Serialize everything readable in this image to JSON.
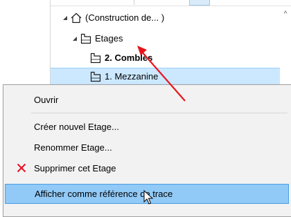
{
  "tree": {
    "items": [
      {
        "label": "(Construction de... )",
        "expanded": true,
        "bold": false,
        "icon": "building-icon"
      },
      {
        "label": "Etages",
        "expanded": true,
        "bold": false,
        "icon": "story-icon"
      },
      {
        "label": "2. Combles",
        "bold": true,
        "icon": "story-icon"
      },
      {
        "label": "1. Mezzanine",
        "bold": false,
        "selected": true,
        "icon": "story-icon"
      }
    ],
    "scroll_up_glyph": "^"
  },
  "context_menu": {
    "items": [
      {
        "label": "Ouvrir"
      },
      {
        "label": "Créer nouvel Etage..."
      },
      {
        "label": "Renommer Etage..."
      },
      {
        "label": "Supprimer cet Etage",
        "icon": "delete-x-icon"
      },
      {
        "label": "Afficher comme référence de trace",
        "hovered": true
      }
    ]
  },
  "colors": {
    "selection_bg": "#cce8ff",
    "menu_bg": "#f2f2f2",
    "menu_hover_bg": "#91c9f7",
    "annotation_arrow": "#e8141c",
    "delete_icon": "#e81123"
  }
}
